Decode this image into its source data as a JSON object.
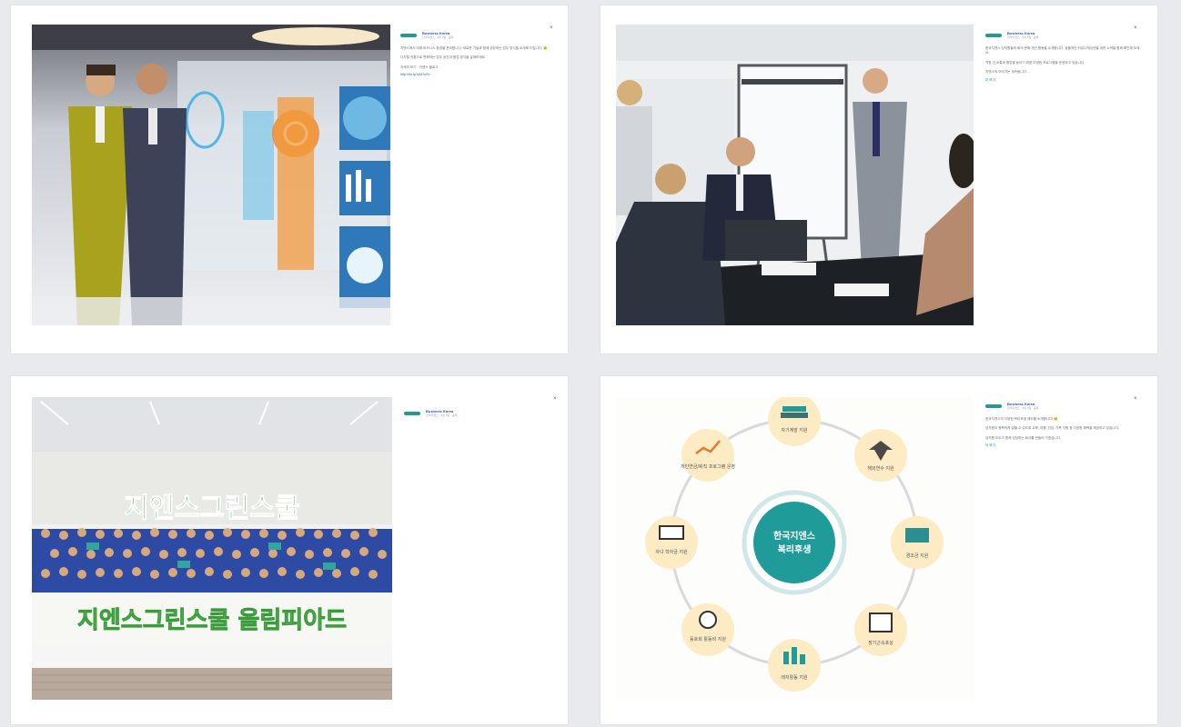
{
  "posts": [
    {
      "brand": "Business Korea",
      "sub": "한국지엔스 · 3월 7일 · 공유",
      "paragraphs": [
        "지엔스에서 미래 비즈니스 환경을 준비합니다. 새로운 기술과 함께 성장하는 업무 방식을 소개해 드립니다. 😊",
        "디지털 전환으로 변화하는 업무 공간과 협업 방식을 살펴보세요.",
        "자세히 보기 · 지엔스 블로그"
      ],
      "link": "http://bit.ly/1kM7uPb"
    },
    {
      "brand": "Business Korea",
      "sub": "한국지엔스 · 3월 5일 · 공유",
      "paragraphs": [
        "한국지엔스 임직원들의 회의 문화 개선 활동을 소개합니다. 효율적인 커뮤니케이션을 위한 노력을 함께 확인해 보세요.",
        "직원 간 소통과 협업을 높이기 위한 다양한 프로그램을 운영하고 있습니다.",
        "지엔스의 이야기는 계속됩니다 …"
      ],
      "link": "더 보기"
    },
    {
      "brand": "Business Korea",
      "sub": "한국지엔스 · 3월 3일 · 공유"
    },
    {
      "brand": "Business Korea",
      "sub": "한국지엔스 · 3월 1일 · 공유",
      "paragraphs": [
        "한국지엔스의 다양한 복리후생 제도를 소개합니다! 😊",
        "임직원이 행복하게 일할 수 있도록 교육, 여행, 건강, 가족 지원 등 다양한 혜택을 제공하고 있습니다.",
        "임직원 모두가 함께 성장하는 회사를 만들어 가겠습니다."
      ],
      "link": "더 보기"
    }
  ],
  "school": {
    "banner_top": "지엔스그린스쿨",
    "banner_bottom": "지엔스그린스쿨 올림피아드"
  },
  "welfare": {
    "center": [
      "한국지엔스",
      "복리후생"
    ],
    "nodes": [
      {
        "label": "자기계발 지원",
        "icon": "books-icon"
      },
      {
        "label": "해외연수 지원",
        "icon": "airplane-icon"
      },
      {
        "label": "경조금 지원",
        "icon": "money-icon"
      },
      {
        "label": "장기근속포상",
        "icon": "calendar-icon"
      },
      {
        "label": "레저활동 지원",
        "icon": "leisure-icon"
      },
      {
        "label": "동호회 활동비 지원",
        "icon": "sports-icon"
      },
      {
        "label": "자녀 학자금 지원",
        "icon": "school-icon"
      },
      {
        "label": "개인연금/퇴직 프로그램 운영",
        "icon": "chart-icon"
      }
    ]
  },
  "colors": {
    "background": "#e9eaee",
    "teal": "#1f9b9a",
    "link": "#2b67c9",
    "school_green": "#3a9b3a"
  },
  "close_glyph": "×"
}
